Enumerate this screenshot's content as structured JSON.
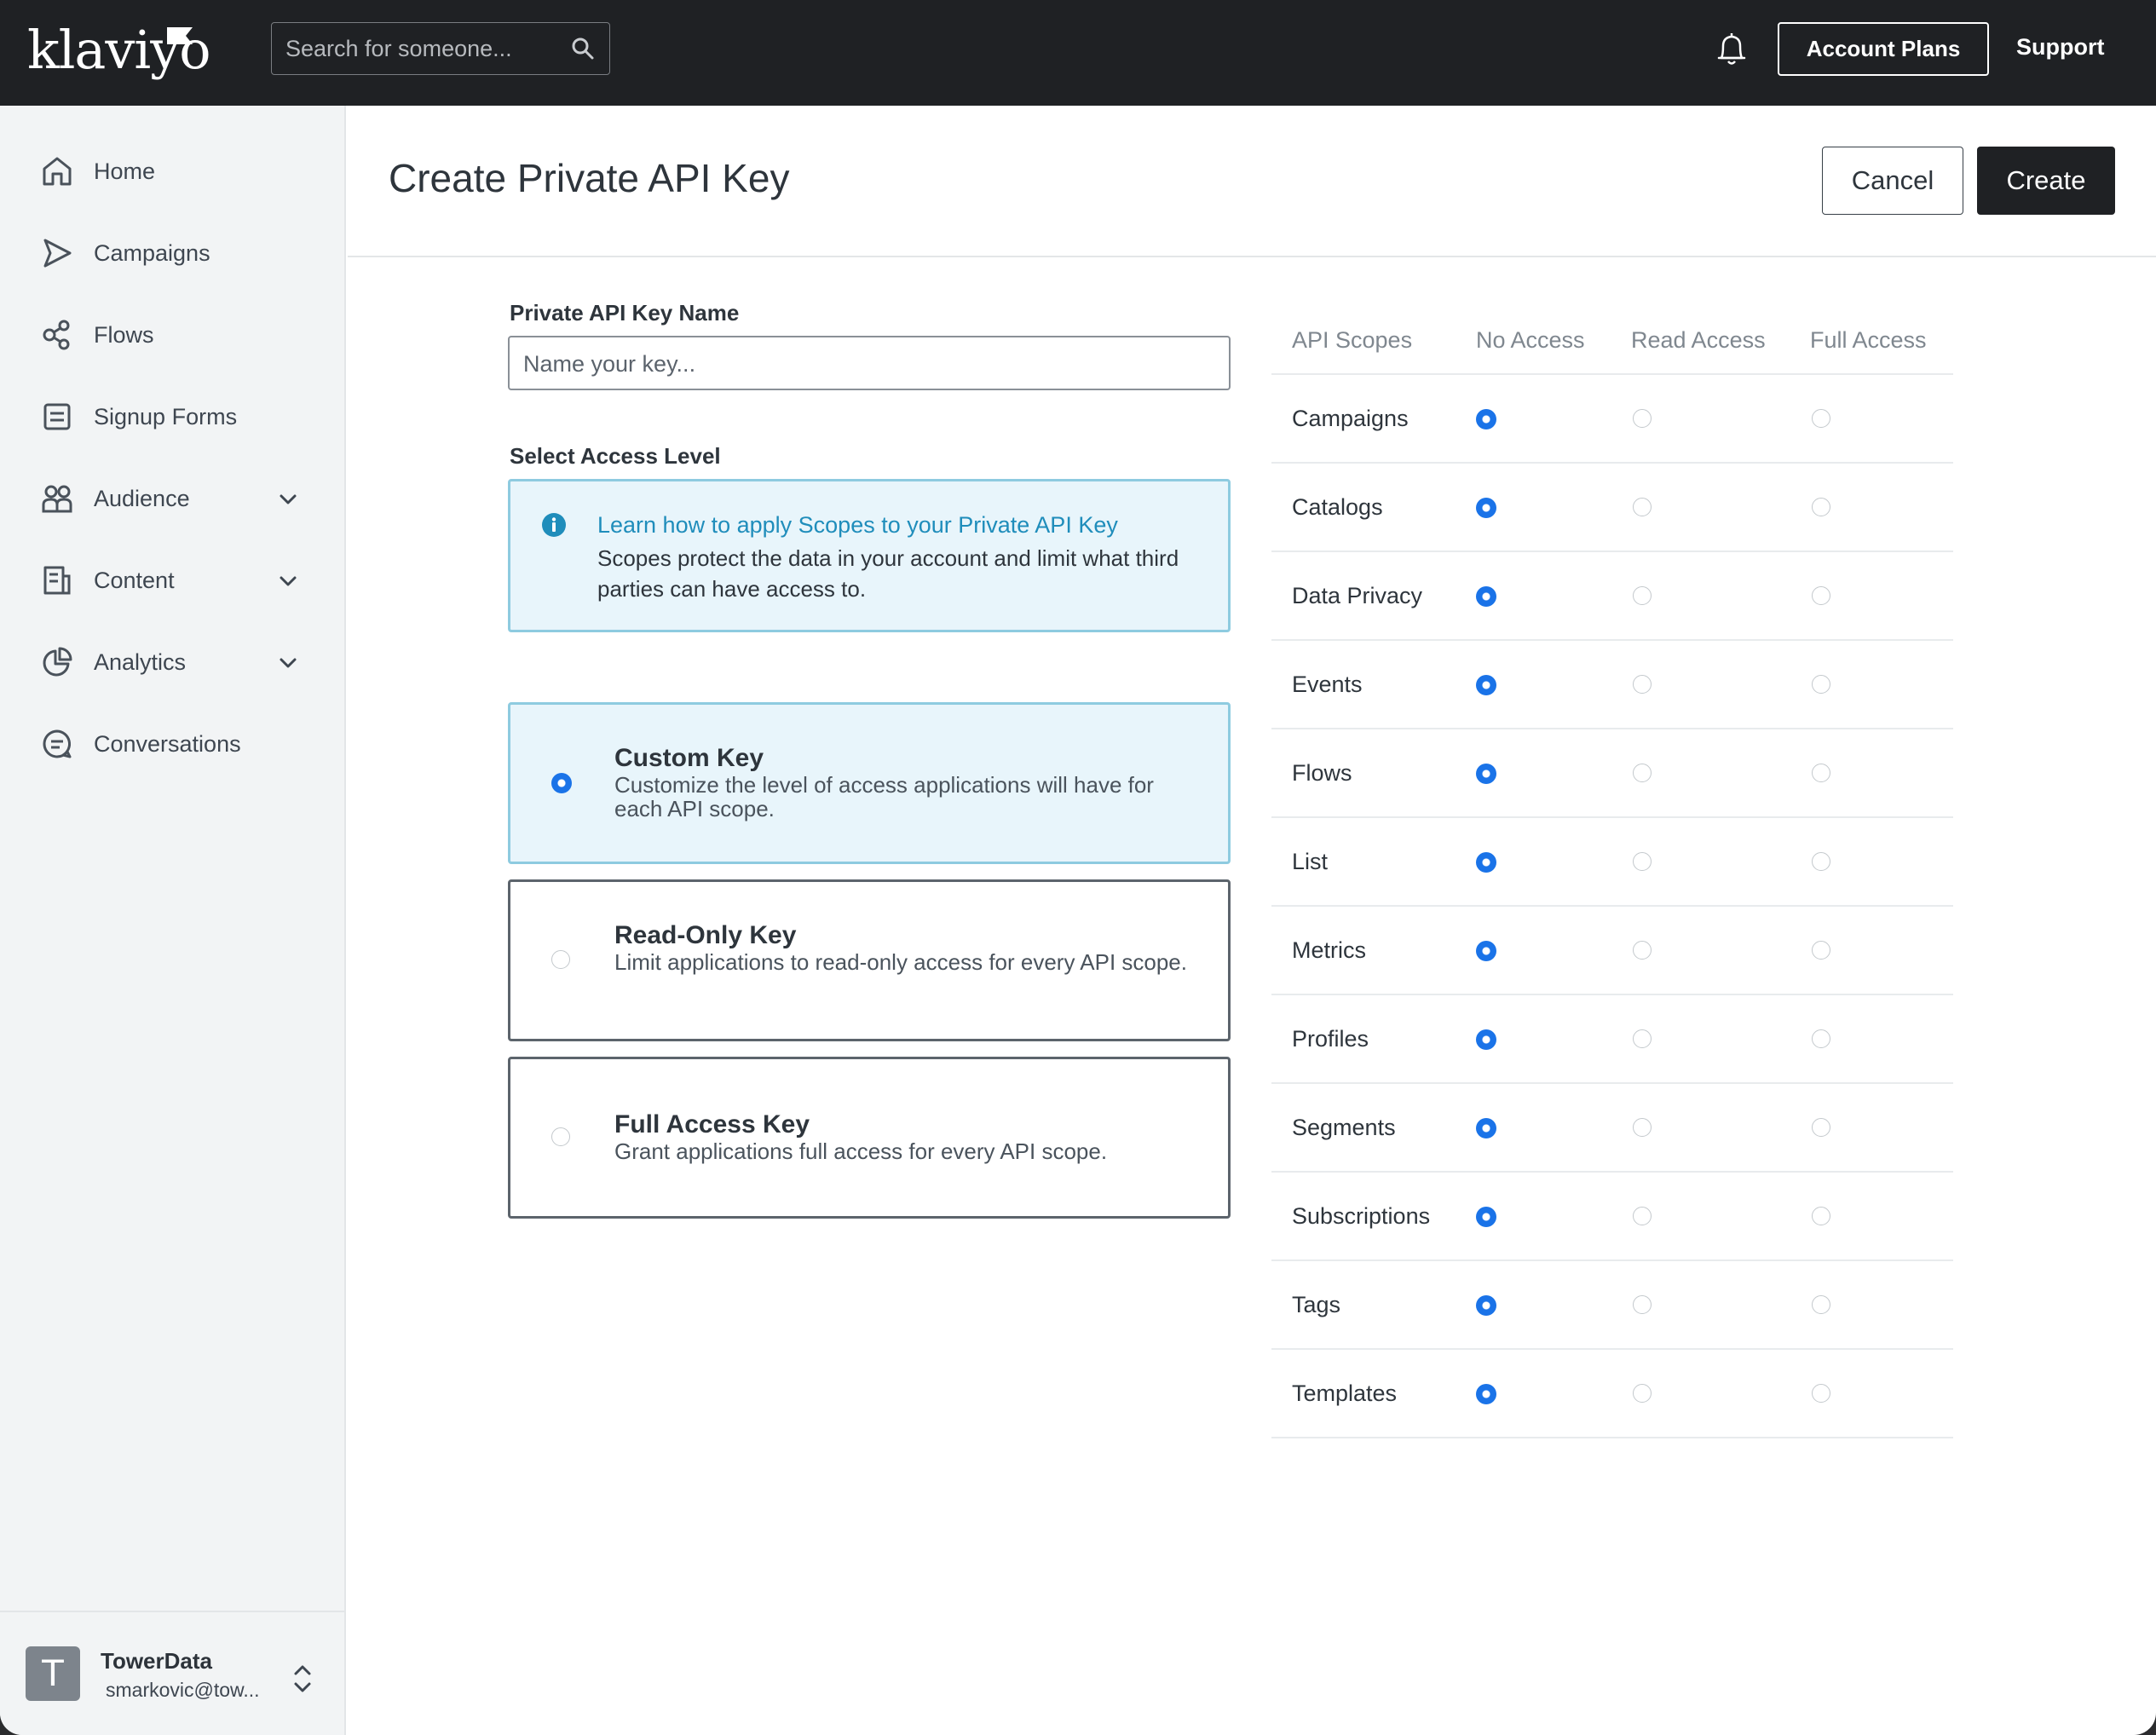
{
  "topbar": {
    "logo": "klaviyo",
    "search_placeholder": "Search for someone...",
    "account_plans": "Account Plans",
    "support": "Support"
  },
  "sidebar": {
    "items": [
      {
        "label": "Home",
        "icon": "home-icon"
      },
      {
        "label": "Campaigns",
        "icon": "send-icon"
      },
      {
        "label": "Flows",
        "icon": "flows-icon"
      },
      {
        "label": "Signup Forms",
        "icon": "form-icon"
      },
      {
        "label": "Audience",
        "icon": "users-icon",
        "expandable": true
      },
      {
        "label": "Content",
        "icon": "content-icon",
        "expandable": true
      },
      {
        "label": "Analytics",
        "icon": "pie-chart-icon",
        "expandable": true
      },
      {
        "label": "Conversations",
        "icon": "chat-icon"
      }
    ],
    "account": {
      "initial": "T",
      "name": "TowerData",
      "email": "smarkovic@tow..."
    }
  },
  "header": {
    "title": "Create Private API Key",
    "cancel": "Cancel",
    "create": "Create"
  },
  "form": {
    "name_label": "Private API Key Name",
    "name_placeholder": "Name your key...",
    "access_label": "Select Access Level",
    "info_link": "Learn how to apply Scopes to your Private API Key",
    "info_text": "Scopes protect the data in your account and limit what third parties can have access to.",
    "options": [
      {
        "title": "Custom Key",
        "desc": "Customize the level of access applications will have for each API scope.",
        "selected": true
      },
      {
        "title": "Read-Only Key",
        "desc": "Limit applications to read-only access for every API scope.",
        "selected": false
      },
      {
        "title": "Full Access Key",
        "desc": "Grant applications full access for every API scope.",
        "selected": false
      }
    ]
  },
  "scopes": {
    "headers": [
      "API Scopes",
      "No Access",
      "Read Access",
      "Full Access"
    ],
    "rows": [
      {
        "name": "Campaigns",
        "access": "none"
      },
      {
        "name": "Catalogs",
        "access": "none"
      },
      {
        "name": "Data Privacy",
        "access": "none"
      },
      {
        "name": "Events",
        "access": "none"
      },
      {
        "name": "Flows",
        "access": "none"
      },
      {
        "name": "List",
        "access": "none"
      },
      {
        "name": "Metrics",
        "access": "none"
      },
      {
        "name": "Profiles",
        "access": "none"
      },
      {
        "name": "Segments",
        "access": "none"
      },
      {
        "name": "Subscriptions",
        "access": "none"
      },
      {
        "name": "Tags",
        "access": "none"
      },
      {
        "name": "Templates",
        "access": "none"
      }
    ]
  },
  "colors": {
    "topbar": "#1f2124",
    "accent_radio": "#1a73e8",
    "info_bg": "#e8f5fb",
    "info_border": "#8ecbe0",
    "link": "#1f8dbb"
  }
}
